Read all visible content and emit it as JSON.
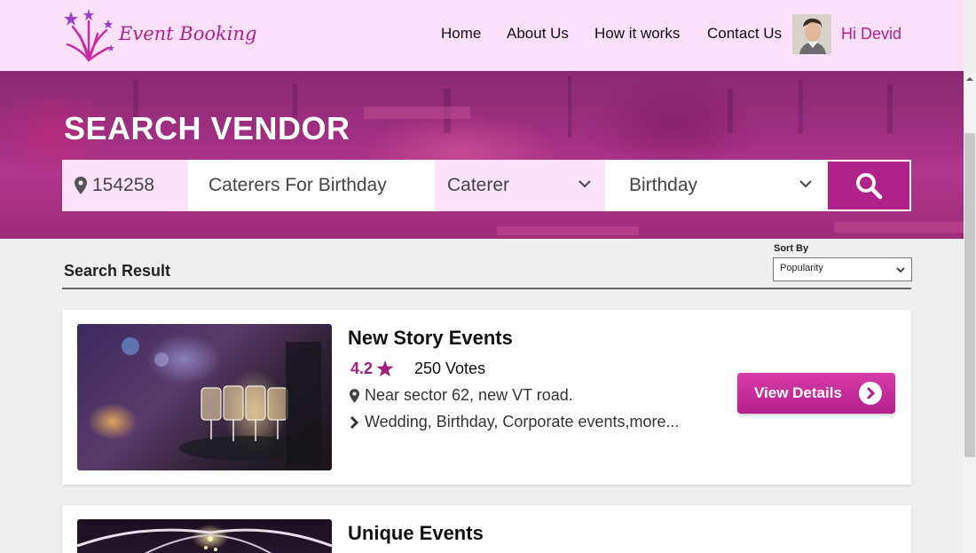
{
  "brand": {
    "name": "Event Booking",
    "icon": "fireworks-logo-icon"
  },
  "nav": {
    "items": [
      "Home",
      "About Us",
      "How it works",
      "Contact Us"
    ]
  },
  "user": {
    "greeting": "Hi Devid",
    "avatar": "user-avatar"
  },
  "hero": {
    "title": "SEARCH VENDOR",
    "search": {
      "location": "154258",
      "query": "Caterers For Birthday",
      "category": "Caterer",
      "occasion": "Birthday",
      "button_icon": "search-icon"
    }
  },
  "results": {
    "title": "Search Result",
    "sort_label": "Sort By",
    "sort_value": "Popularity",
    "vendors": [
      {
        "name": "New Story Events",
        "rating": "4.2",
        "votes": "250 Votes",
        "address": "Near sector 62, new VT road.",
        "services": "Wedding, Birthday, Corporate events,more...",
        "button": "View Details"
      },
      {
        "name": "Unique Events"
      }
    ]
  },
  "colors": {
    "accent": "#b3208f",
    "header_bg": "#fde0f9",
    "button": "#b0218a"
  }
}
